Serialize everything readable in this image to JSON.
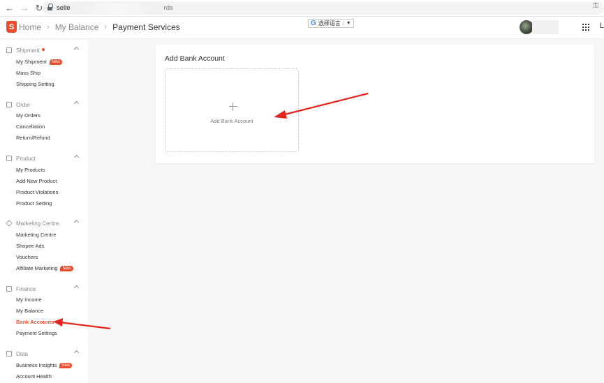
{
  "browser": {
    "url_prefix": "selle",
    "url_suffix": "rds"
  },
  "header": {
    "logo": "S",
    "breadcrumb": [
      "Home",
      "My Balance",
      "Payment Services"
    ],
    "language_selector": "选择语言",
    "language_caret": "▼",
    "edge_glyph": "L"
  },
  "sidebar": {
    "sections": [
      {
        "title": "Shipment",
        "has_dot": true,
        "items": [
          {
            "label": "My Shipment",
            "badge": "New"
          },
          {
            "label": "Mass Ship"
          },
          {
            "label": "Shipping Setting"
          }
        ]
      },
      {
        "title": "Order",
        "items": [
          {
            "label": "My Orders"
          },
          {
            "label": "Cancellation"
          },
          {
            "label": "Return/Refund"
          }
        ]
      },
      {
        "title": "Product",
        "items": [
          {
            "label": "My Products"
          },
          {
            "label": "Add New Product"
          },
          {
            "label": "Product Violations"
          },
          {
            "label": "Product Setting"
          }
        ]
      },
      {
        "title": "Marketing Centre",
        "items": [
          {
            "label": "Marketing Centre"
          },
          {
            "label": "Shopee Ads"
          },
          {
            "label": "Vouchers"
          },
          {
            "label": "Affiliate Marketing",
            "badge": "New"
          }
        ]
      },
      {
        "title": "Finance",
        "items": [
          {
            "label": "My Income"
          },
          {
            "label": "My Balance"
          },
          {
            "label": "Bank Accounts",
            "active": true
          },
          {
            "label": "Payment Settings"
          }
        ]
      },
      {
        "title": "Data",
        "items": [
          {
            "label": "Business Insights",
            "badge": "New"
          },
          {
            "label": "Account Health"
          }
        ]
      }
    ]
  },
  "main": {
    "card_title": "Add Bank Account",
    "add_box_label": "Add Bank Account"
  },
  "colors": {
    "accent": "#ee4d2d",
    "annotation": "#e8231d"
  }
}
